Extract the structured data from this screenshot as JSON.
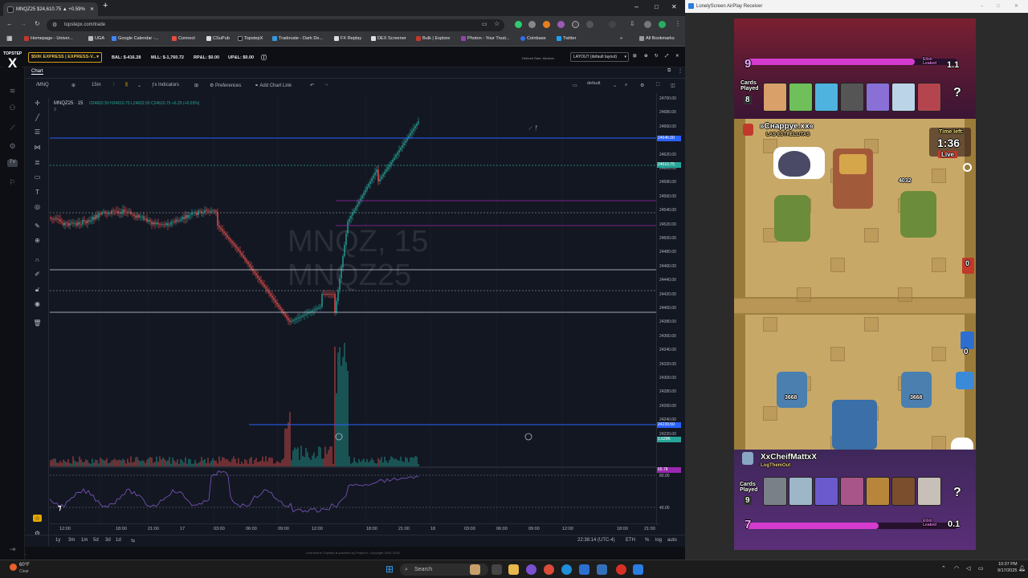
{
  "browser": {
    "tab_title": "MNQZ25 $24,610.75 ▲ +0.59%",
    "url": "topstepx.com/trade",
    "bookmarks": [
      "Homepage - Univer...",
      "UGA",
      "Google Calendar -...",
      "Connect",
      "CSuPub",
      "TopstepX",
      "Tradovate - Dark De...",
      "FX Replay",
      "DEX Screener",
      "Bulk | Explore",
      "Photon - Your Trust...",
      "Coinbase",
      "Twitter",
      "All Bookmarks"
    ]
  },
  "app": {
    "logo_top": "TOPSTEP",
    "logo_letter": "X",
    "account": "$50K EXPRESS | EXPRESS-V...",
    "bal": "BAL: $-416.28",
    "mll": "MLL: $-1,760.72",
    "rpnl": "RP&L: $0.00",
    "upnl": "UP&L: $0.00",
    "refresh_note": "Refresh Rate: Medium",
    "layout_select": "LAYOUT (default layout)"
  },
  "chart": {
    "tab_label": "Chart",
    "symbol_search": "/MNQ",
    "interval": "15m",
    "indicators_label": "Indicators",
    "preferences_label": "Preferences",
    "add_chart_link_label": "Add Chart Link",
    "template": "default",
    "legend_symbol": "MNQZ25 · 15",
    "legend_ohlc": "O24602.50 H24610.75 L24602.50 C24610.75 +6.25 (+0.03%)",
    "legend_count": "3",
    "watermark_line1": "MNQZ, 15",
    "watermark_line2": "MNQZ25",
    "price_labels": [
      "24700.00",
      "24680.00",
      "24660.00",
      "24640.00",
      "24620.00",
      "24600.00",
      "24580.00",
      "24560.00",
      "24540.00",
      "24520.00",
      "24500.00",
      "24480.00",
      "24460.00",
      "24440.00",
      "24420.00",
      "24400.00",
      "24380.00",
      "24360.00",
      "24340.00",
      "24320.00",
      "24300.00",
      "24280.00",
      "24260.00",
      "24240.00",
      "24220.00"
    ],
    "price_badges": {
      "upper": "24646.00",
      "last": "24610.75",
      "lower": "24239.50",
      "volume": "1.629K",
      "rsi": "65.78"
    },
    "rsi_labels": [
      "80.00",
      "40.00"
    ],
    "time_labels": [
      "12:00",
      "18:00",
      "21:00",
      "17",
      "03:00",
      "06:00",
      "09:00",
      "12:00",
      "18:00",
      "21:00",
      "18",
      "03:00",
      "06:00",
      "09:00",
      "12:00",
      "18:00",
      "21:00"
    ],
    "ranges": [
      "1y",
      "3m",
      "1m",
      "5d",
      "3d",
      "1d"
    ],
    "clock": "22:38:14 (UTC-4)",
    "session": "ETH",
    "pct": "%",
    "log": "log",
    "auto": "auto",
    "license": "Licensed to Topstep ● powered by ProjectX. Copyright 2024-2025",
    "chart_data": {
      "type": "candlestick",
      "title": "MNQZ25 · 15",
      "ylim": [
        24220,
        24700
      ],
      "levels": [
        24646.0,
        24610.75,
        24239.5
      ],
      "last": 24610.75
    }
  },
  "airplay": {
    "title": "LonelyScreen AirPlay Receiver"
  },
  "game": {
    "opp_elixir": "9",
    "opp_elixir_leaked_label": "Elixir\nLeaked",
    "opp_elixir_leaked": "1.1",
    "cards_played_label": "Cards\nPlayed",
    "opp_cards_played": "8",
    "opp_name": "»Cнappye.xx«",
    "opp_clan": "LAS ESTRELLITAS",
    "time_left_label": "Time left:",
    "time_left": "1:36",
    "live": "Live",
    "opp_king_hp": "4032",
    "player_tower_left": "3668",
    "player_tower_right": "3668",
    "player_name": "XxCheifMattxX",
    "player_clan": "LogThemOut",
    "player_cards_played": "9",
    "player_elixir": "7",
    "player_elixir_leaked": "0.1",
    "crown_opp": "0",
    "crown_player": "0",
    "question": "?"
  },
  "taskbar": {
    "weather_temp": "60°F",
    "weather_desc": "Clear",
    "search_placeholder": "Search",
    "time": "10:37 PM",
    "date": "9/17/2025"
  }
}
